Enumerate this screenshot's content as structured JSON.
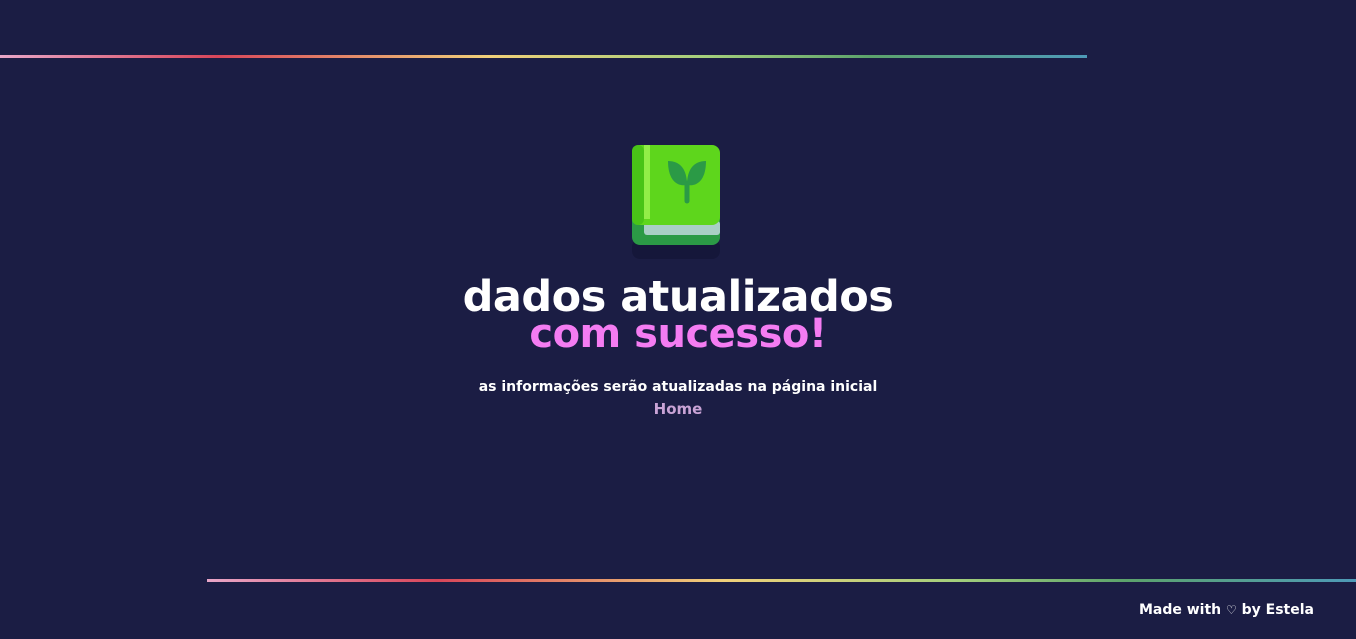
{
  "main": {
    "title": "dados atualizados",
    "subtitle": "com sucesso!",
    "info": "as informações serão atualizadas na página inicial",
    "home_link": "Home"
  },
  "footer": {
    "made_with": "Made with",
    "heart": "♡",
    "by": "by Estela"
  },
  "icons": {
    "book": "book-with-sprout-icon",
    "heart": "heart-icon"
  },
  "colors": {
    "background": "#1b1d44",
    "title": "#ffffff",
    "subtitle": "#f47cf2",
    "link": "#c9a3d6"
  }
}
